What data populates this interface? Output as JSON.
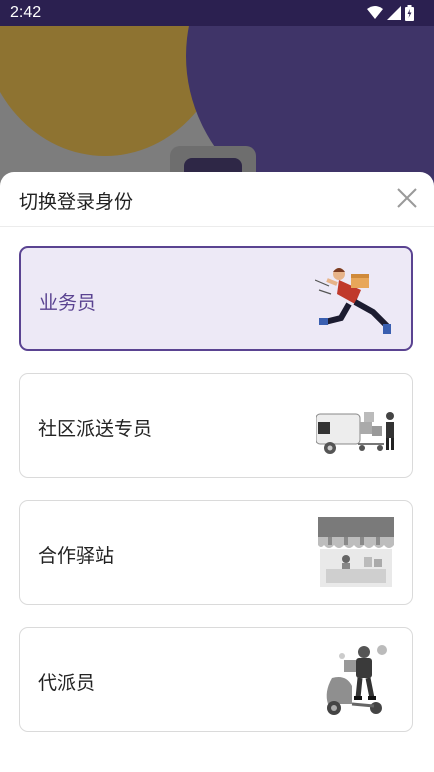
{
  "status_bar": {
    "time": "2:42",
    "icons": [
      "wifi-icon",
      "cell-signal-icon",
      "battery-icon"
    ]
  },
  "sheet": {
    "title": "切换登录身份",
    "close_icon": "close-icon"
  },
  "roles": [
    {
      "label": "业务员",
      "selected": true,
      "illustration": "courier-running-illustration"
    },
    {
      "label": "社区派送专员",
      "selected": false,
      "illustration": "delivery-van-illustration"
    },
    {
      "label": "合作驿站",
      "selected": false,
      "illustration": "storefront-illustration"
    },
    {
      "label": "代派员",
      "selected": false,
      "illustration": "scooter-courier-illustration"
    }
  ],
  "colors": {
    "accent": "#5a4391",
    "selected_bg": "#ede9f6",
    "status_bar_bg": "#2b2050"
  }
}
